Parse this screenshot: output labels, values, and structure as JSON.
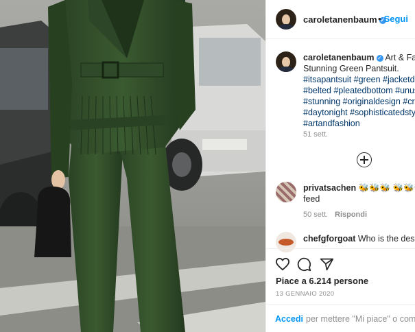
{
  "header": {
    "username": "caroletanenbaum",
    "follow_label": "Segui",
    "separator": "•"
  },
  "caption": {
    "username": "caroletanenbaum",
    "title_text": "Art & Fashion",
    "line1": "Stunning Green Pantsuit.",
    "hashtags": [
      "#itsapantsuit #green #jacketdesign",
      "#belted #pleatedbottom #unusual",
      "#stunning #originaldesign #creative",
      "#daytonight #sophisticatedstyle",
      "#artandfashion"
    ],
    "time": "51 sett."
  },
  "load_more_icon": "plus-circle-icon",
  "comments": [
    {
      "username": "privatsachen",
      "emoji": "🐝🐝🐝 🐝🐝🐝",
      "text_cont": "feed",
      "time": "50 sett.",
      "reply_label": "Rispondi"
    },
    {
      "username": "chefgforgoat",
      "text": "Who is the designer?"
    }
  ],
  "actions": {
    "like_icon": "heart-icon",
    "comment_icon": "comment-icon",
    "share_icon": "share-icon",
    "likes": "Piace a 6.214 persone",
    "date": "13 GENNAIO 2020"
  },
  "login": {
    "link": "Accedi",
    "text": "per mettere \"Mi piace\" o commentare."
  },
  "colors": {
    "link_blue": "#0095f6",
    "hashtag": "#00376b",
    "suit_green": "#2f4a28",
    "muted": "#8e8e8e"
  }
}
